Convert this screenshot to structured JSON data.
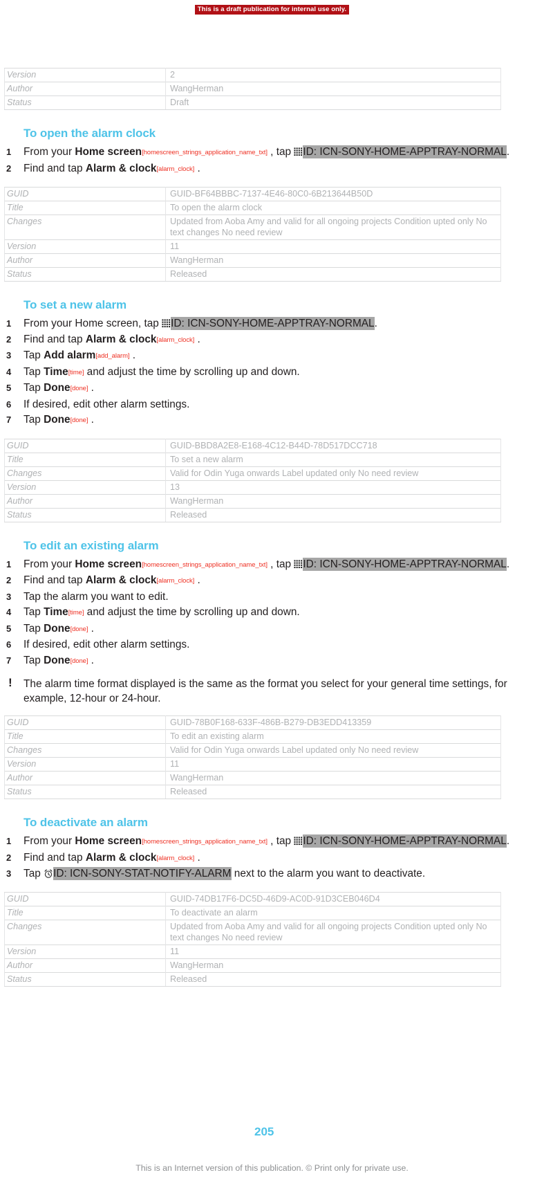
{
  "draft_banner": "This is a draft publication for internal use only.",
  "meta_table_top": {
    "rows": [
      {
        "key": "Version",
        "value": "2"
      },
      {
        "key": "Author",
        "value": "WangHerman"
      },
      {
        "key": "Status",
        "value": "Draft"
      }
    ]
  },
  "sections": [
    {
      "heading": "To open the alarm clock",
      "steps": [
        {
          "num": "1",
          "parts": [
            {
              "t": "text",
              "v": "From your "
            },
            {
              "t": "bold",
              "v": "Home screen"
            },
            {
              "t": "token",
              "v": "[homescreen_strings_application_name_txt]"
            },
            {
              "t": "text",
              "v": " , tap "
            },
            {
              "t": "icon",
              "v": "apptray-grid-icon"
            },
            {
              "t": "highlight",
              "v": "ID: ICN-SONY-HOME-APPTRAY-NORMAL"
            },
            {
              "t": "text",
              "v": "."
            }
          ]
        },
        {
          "num": "2",
          "parts": [
            {
              "t": "text",
              "v": "Find and tap "
            },
            {
              "t": "bold",
              "v": "Alarm & clock"
            },
            {
              "t": "token",
              "v": "[alarm_clock]"
            },
            {
              "t": "text",
              "v": " ."
            }
          ]
        }
      ],
      "meta": {
        "rows": [
          {
            "key": "GUID",
            "value": "GUID-BF64BBBC-7137-4E46-80C0-6B213644B50D"
          },
          {
            "key": "Title",
            "value": "To open the alarm clock"
          },
          {
            "key": "Changes",
            "value": "Updated from Aoba Amy and valid for all ongoing projects Condition upted only No text changes No need review"
          },
          {
            "key": "Version",
            "value": "11"
          },
          {
            "key": "Author",
            "value": "WangHerman"
          },
          {
            "key": "Status",
            "value": "Released"
          }
        ]
      }
    },
    {
      "heading": "To set a new alarm",
      "steps": [
        {
          "num": "1",
          "parts": [
            {
              "t": "text",
              "v": "From your Home screen, tap "
            },
            {
              "t": "icon",
              "v": "apptray-grid-icon"
            },
            {
              "t": "highlight",
              "v": "ID: ICN-SONY-HOME-APPTRAY-NORMAL"
            },
            {
              "t": "text",
              "v": "."
            }
          ]
        },
        {
          "num": "2",
          "parts": [
            {
              "t": "text",
              "v": "Find and tap "
            },
            {
              "t": "bold",
              "v": "Alarm & clock"
            },
            {
              "t": "token",
              "v": "[alarm_clock]"
            },
            {
              "t": "text",
              "v": " ."
            }
          ]
        },
        {
          "num": "3",
          "parts": [
            {
              "t": "text",
              "v": "Tap "
            },
            {
              "t": "bold",
              "v": "Add alarm"
            },
            {
              "t": "token",
              "v": "[add_alarm]"
            },
            {
              "t": "text",
              "v": " ."
            }
          ]
        },
        {
          "num": "4",
          "parts": [
            {
              "t": "text",
              "v": "Tap "
            },
            {
              "t": "bold",
              "v": "Time"
            },
            {
              "t": "token",
              "v": "[time]"
            },
            {
              "t": "text",
              "v": " and adjust the time by scrolling up and down."
            }
          ]
        },
        {
          "num": "5",
          "parts": [
            {
              "t": "text",
              "v": "Tap "
            },
            {
              "t": "bold",
              "v": "Done"
            },
            {
              "t": "token",
              "v": "[done]"
            },
            {
              "t": "text",
              "v": " ."
            }
          ]
        },
        {
          "num": "6",
          "parts": [
            {
              "t": "text",
              "v": "If desired, edit other alarm settings."
            }
          ]
        },
        {
          "num": "7",
          "parts": [
            {
              "t": "text",
              "v": "Tap "
            },
            {
              "t": "bold",
              "v": "Done"
            },
            {
              "t": "token",
              "v": "[done]"
            },
            {
              "t": "text",
              "v": " ."
            }
          ]
        }
      ],
      "meta": {
        "rows": [
          {
            "key": "GUID",
            "value": "GUID-BBD8A2E8-E168-4C12-B44D-78D517DCC718"
          },
          {
            "key": "Title",
            "value": "To set a new alarm"
          },
          {
            "key": "Changes",
            "value": "Valid for Odin Yuga onwards Label updated only No need review"
          },
          {
            "key": "Version",
            "value": "13"
          },
          {
            "key": "Author",
            "value": "WangHerman"
          },
          {
            "key": "Status",
            "value": "Released"
          }
        ]
      }
    },
    {
      "heading": "To edit an existing alarm",
      "steps": [
        {
          "num": "1",
          "parts": [
            {
              "t": "text",
              "v": "From your "
            },
            {
              "t": "bold",
              "v": "Home screen"
            },
            {
              "t": "token",
              "v": "[homescreen_strings_application_name_txt]"
            },
            {
              "t": "text",
              "v": " , tap "
            },
            {
              "t": "icon",
              "v": "apptray-grid-icon"
            },
            {
              "t": "highlight",
              "v": "ID: ICN-SONY-HOME-APPTRAY-NORMAL"
            },
            {
              "t": "text",
              "v": "."
            }
          ]
        },
        {
          "num": "2",
          "parts": [
            {
              "t": "text",
              "v": "Find and tap "
            },
            {
              "t": "bold",
              "v": "Alarm & clock"
            },
            {
              "t": "token",
              "v": "[alarm_clock]"
            },
            {
              "t": "text",
              "v": " ."
            }
          ]
        },
        {
          "num": "3",
          "parts": [
            {
              "t": "text",
              "v": "Tap the alarm you want to edit."
            }
          ]
        },
        {
          "num": "4",
          "parts": [
            {
              "t": "text",
              "v": "Tap "
            },
            {
              "t": "bold",
              "v": "Time"
            },
            {
              "t": "token",
              "v": "[time]"
            },
            {
              "t": "text",
              "v": " and adjust the time by scrolling up and down."
            }
          ]
        },
        {
          "num": "5",
          "parts": [
            {
              "t": "text",
              "v": "Tap "
            },
            {
              "t": "bold",
              "v": "Done"
            },
            {
              "t": "token",
              "v": "[done]"
            },
            {
              "t": "text",
              "v": " ."
            }
          ]
        },
        {
          "num": "6",
          "parts": [
            {
              "t": "text",
              "v": "If desired, edit other alarm settings."
            }
          ]
        },
        {
          "num": "7",
          "parts": [
            {
              "t": "text",
              "v": "Tap "
            },
            {
              "t": "bold",
              "v": "Done"
            },
            {
              "t": "token",
              "v": "[done]"
            },
            {
              "t": "text",
              "v": " ."
            }
          ]
        }
      ],
      "note": "The alarm time format displayed is the same as the format you select for your general time settings, for example, 12-hour or 24-hour.",
      "note_icon": "exclamation-icon",
      "meta": {
        "rows": [
          {
            "key": "GUID",
            "value": "GUID-78B0F168-633F-486B-B279-DB3EDD413359"
          },
          {
            "key": "Title",
            "value": "To edit an existing alarm"
          },
          {
            "key": "Changes",
            "value": "Valid for Odin Yuga onwards Label updated only No need review"
          },
          {
            "key": "Version",
            "value": "11"
          },
          {
            "key": "Author",
            "value": "WangHerman"
          },
          {
            "key": "Status",
            "value": "Released"
          }
        ]
      }
    },
    {
      "heading": "To deactivate an alarm",
      "steps": [
        {
          "num": "1",
          "parts": [
            {
              "t": "text",
              "v": "From your "
            },
            {
              "t": "bold",
              "v": "Home screen"
            },
            {
              "t": "token",
              "v": "[homescreen_strings_application_name_txt]"
            },
            {
              "t": "text",
              "v": " , tap "
            },
            {
              "t": "icon",
              "v": "apptray-grid-icon"
            },
            {
              "t": "highlight",
              "v": "ID: ICN-SONY-HOME-APPTRAY-NORMAL"
            },
            {
              "t": "text",
              "v": "."
            }
          ]
        },
        {
          "num": "2",
          "parts": [
            {
              "t": "text",
              "v": "Find and tap "
            },
            {
              "t": "bold",
              "v": "Alarm & clock"
            },
            {
              "t": "token",
              "v": "[alarm_clock]"
            },
            {
              "t": "text",
              "v": " ."
            }
          ]
        },
        {
          "num": "3",
          "parts": [
            {
              "t": "text",
              "v": "Tap "
            },
            {
              "t": "icon",
              "v": "alarm-clock-icon"
            },
            {
              "t": "highlight",
              "v": "ID: ICN-SONY-STAT-NOTIFY-ALARM"
            },
            {
              "t": "text",
              "v": " next to the alarm you want to deactivate."
            }
          ]
        }
      ],
      "meta": {
        "rows": [
          {
            "key": "GUID",
            "value": "GUID-74DB17F6-DC5D-46D9-AC0D-91D3CEB046D4"
          },
          {
            "key": "Title",
            "value": "To deactivate an alarm"
          },
          {
            "key": "Changes",
            "value": "Updated from Aoba Amy and valid for all ongoing projects Condition upted only No text changes No need review"
          },
          {
            "key": "Version",
            "value": "11"
          },
          {
            "key": "Author",
            "value": "WangHerman"
          },
          {
            "key": "Status",
            "value": "Released"
          }
        ]
      }
    }
  ],
  "page_number": "205",
  "footer_note": "This is an Internet version of this publication. © Print only for private use.",
  "colors": {
    "heading": "#4ec3e8",
    "token": "#ee3124",
    "highlight": "#a6a6a6",
    "banner": "#b11116",
    "meta_text": "#b0b2b4"
  }
}
